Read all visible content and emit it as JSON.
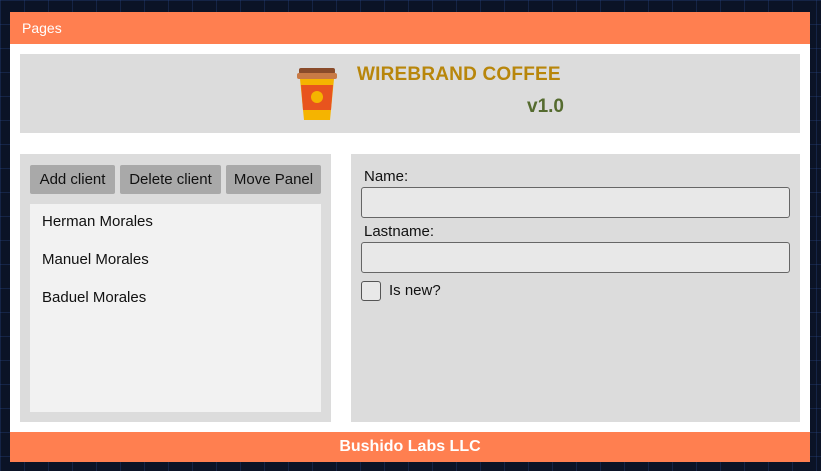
{
  "topbar": {
    "label": "Pages"
  },
  "header": {
    "logo_icon": "coffee-cup-icon",
    "title": "WIREBRAND COFFEE",
    "version": "v1.0",
    "title_color": "#b8860b",
    "version_color": "#556b2f"
  },
  "toolbar": {
    "add_label": "Add client",
    "delete_label": "Delete client",
    "move_label": "Move Panel"
  },
  "clients": [
    "Herman Morales",
    "Manuel Morales",
    "Baduel Morales"
  ],
  "form": {
    "name_label": "Name:",
    "name_value": "",
    "lastname_label": "Lastname:",
    "lastname_value": "",
    "is_new_label": "Is new?",
    "is_new_checked": false
  },
  "footer": {
    "label": "Bushido Labs LLC"
  },
  "theme": {
    "accent": "#ff7f50",
    "panel": "#dcdcdc"
  }
}
